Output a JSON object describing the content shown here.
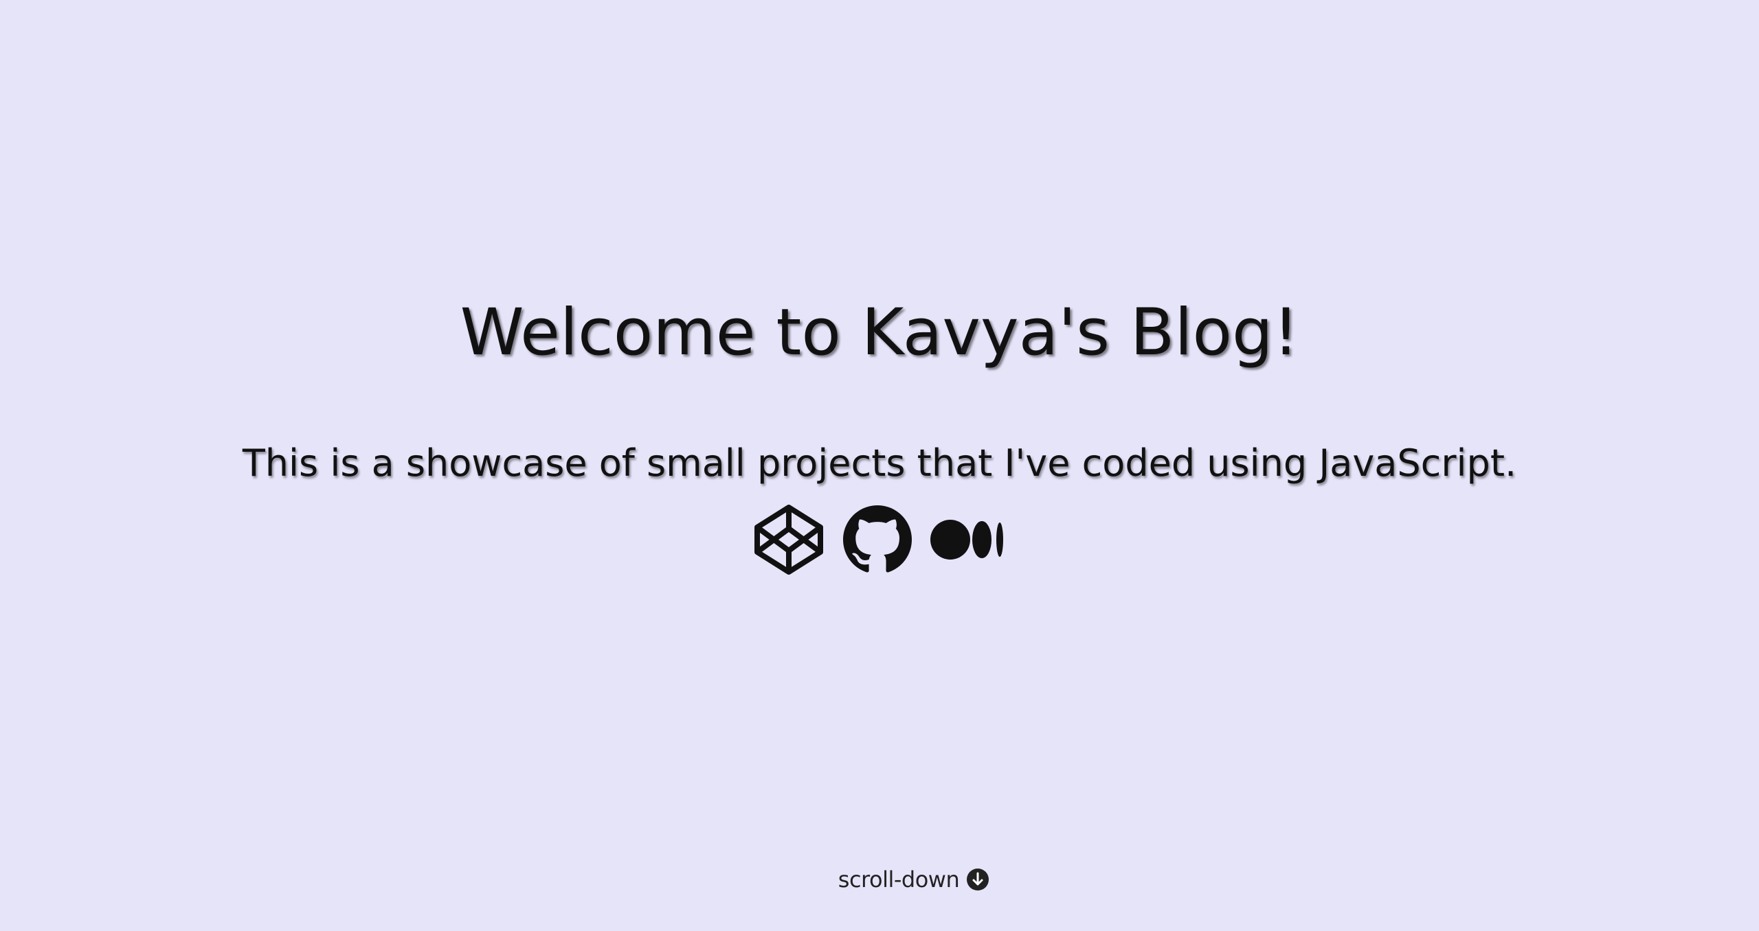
{
  "hero": {
    "title": "Welcome to Kavya's Blog!",
    "subtitle": "This is a showcase of small projects that I've coded using JavaScript."
  },
  "social_links": [
    {
      "name": "CodePen",
      "icon": "codepen-icon"
    },
    {
      "name": "GitHub",
      "icon": "github-icon"
    },
    {
      "name": "Medium",
      "icon": "medium-icon"
    }
  ],
  "scroll": {
    "label": "scroll-down",
    "icon": "arrow-down-circle-icon"
  },
  "colors": {
    "background": "#e6e4f9",
    "text": "#111111"
  }
}
